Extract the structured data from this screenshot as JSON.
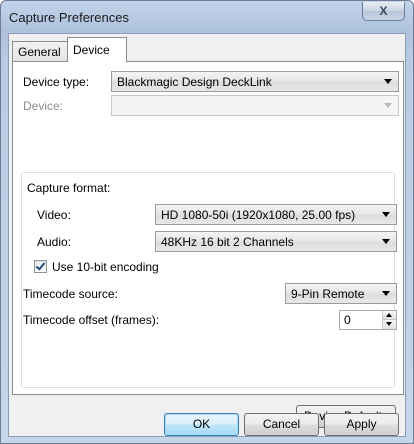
{
  "window": {
    "title": "Capture Preferences",
    "close_glyph": "X"
  },
  "tabs": [
    {
      "label": "General",
      "selected": false
    },
    {
      "label": "Device",
      "selected": true
    }
  ],
  "device": {
    "type_label": "Device type:",
    "type_value": "Blackmagic Design DeckLink",
    "device_label": "Device:",
    "device_value": ""
  },
  "capture_format": {
    "group_label": "Capture format:",
    "video_label": "Video:",
    "video_value": "HD 1080-50i (1920x1080, 25.00 fps)",
    "audio_label": "Audio:",
    "audio_value": "48KHz 16 bit 2 Channels",
    "ten_bit_label": "Use 10-bit encoding",
    "ten_bit_checked": true,
    "timecode_source_label": "Timecode source:",
    "timecode_source_value": "9-Pin Remote",
    "timecode_offset_label": "Timecode offset (frames):",
    "timecode_offset_value": "0"
  },
  "buttons": {
    "device_defaults": "Device Defaults",
    "ok": "OK",
    "cancel": "Cancel",
    "apply": "Apply"
  }
}
